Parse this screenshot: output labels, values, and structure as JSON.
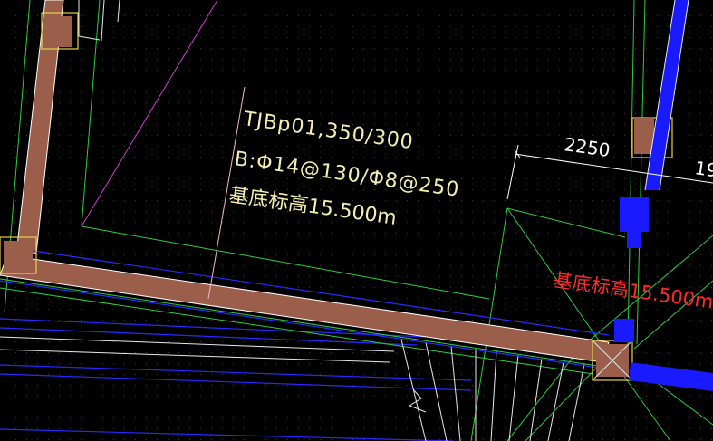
{
  "viewport": {
    "background": "#000000",
    "dot_grid_color": "#3a3a3a"
  },
  "annotation": {
    "foundation_code": "TJBp01,350/300",
    "reinforcement": "B:Φ14@130/Φ8@250",
    "elevation_label": "基底标高15.500m",
    "color": "#f2efb0"
  },
  "annotation_secondary": {
    "elevation_label": "基底标高15.500m",
    "color": "#ff2a2a"
  },
  "dimension": {
    "value": "2250",
    "next_value_partial": "19",
    "color": "#ffffff"
  },
  "colors": {
    "beam_fill": "#9b5e4a",
    "beam_edge": "#ffffff",
    "column_outline": "#e6d24a",
    "blue_wall": "#1a1aff",
    "blue_line": "#2a2aff",
    "green_line": "#2ecc40",
    "magenta_line": "#d23fd2",
    "white_line": "#e8e8e8",
    "pink_leader": "#f2b9c8"
  }
}
